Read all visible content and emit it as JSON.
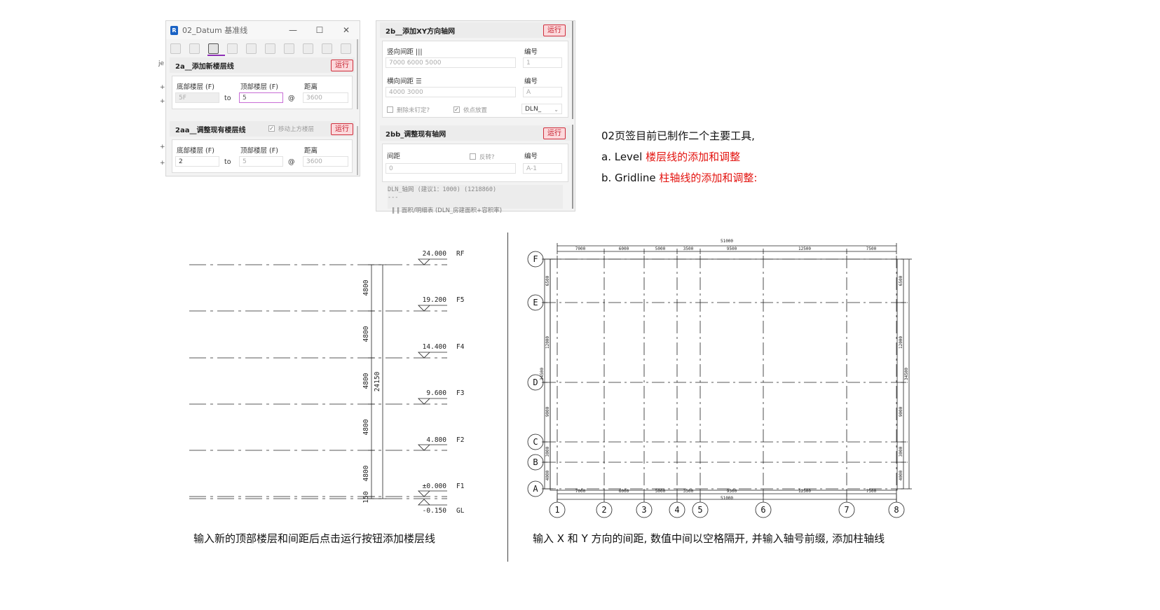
{
  "window1": {
    "title": "02_Datum 基准线",
    "controls": [
      "—",
      "☐",
      "✕"
    ],
    "panel_2a": {
      "title": "2a__添加新楼层线",
      "run": "运行",
      "bottom_label": "底部楼层 (F)",
      "top_label": "顶部楼层 (F)",
      "dist_label": "距离",
      "bottom_value": "5F",
      "to": "to",
      "top_value": "5",
      "at": "@",
      "dist_value": "3600"
    },
    "panel_2aa": {
      "title": "2aa__调整现有楼层线",
      "move_label": "移动上方楼层",
      "run": "运行",
      "bottom_label": "底部楼层 (F)",
      "top_label": "顶部楼层 (F)",
      "dist_label": "距离",
      "bottom_value": "2",
      "to": "to",
      "top_value": "5",
      "at": "@",
      "dist_value": "3600"
    },
    "left_glyphs": [
      "je",
      "+",
      "+",
      "+",
      "+"
    ]
  },
  "window2": {
    "panel_2b": {
      "title": "2b__添加XY方向轴网",
      "run": "运行",
      "vspacing_label": "竖向间距 |||",
      "vspacing_value": "7000 6000 5000",
      "num_label1": "编号",
      "num_value1": "1",
      "hspacing_label": "横向间距 ☰",
      "hspacing_value": "4000 3000",
      "num_label2": "编号",
      "num_value2": "A",
      "delete_label": "删除未钉定?",
      "snap_label": "依点放置",
      "prefix_value": "DLN_"
    },
    "panel_2bb": {
      "title": "2bb_调整现有轴网",
      "run": "运行",
      "spacing_label": "间距",
      "reverse_label": "反转?",
      "num_label": "编号",
      "spacing_value": "0",
      "num_value": "A-1"
    },
    "log_lines": [
      "DLN_轴网 (建议1：1000)  (1218860)",
      "---",
      "‖ ‖ 面积/明细表 (DLN_房建面积+容积率)"
    ]
  },
  "notes": {
    "line1": "02页签目前已制作二个主要工具,",
    "line2_prefix": "a. Level ",
    "line2_red": "楼层线的添加和调整",
    "line3_prefix": "b. Gridline ",
    "line3_red": "柱轴线的添加和调整:"
  },
  "levels": {
    "items": [
      {
        "elev": "24.000",
        "name": "RF"
      },
      {
        "elev": "19.200",
        "name": "F5"
      },
      {
        "elev": "14.400",
        "name": "F4"
      },
      {
        "elev": "9.600",
        "name": "F3"
      },
      {
        "elev": "4.800",
        "name": "F2"
      },
      {
        "elev": "±0.000",
        "name": "F1"
      },
      {
        "elev": "-0.150",
        "name": "GL"
      }
    ],
    "spacing_dims": [
      "4800",
      "4800",
      "4800",
      "4800",
      "4800",
      "150"
    ],
    "total_dim": "24150",
    "caption": "输入新的顶部楼层和间距后点击运行按钮添加楼层线"
  },
  "grid": {
    "columns": [
      "1",
      "2",
      "3",
      "4",
      "5",
      "6",
      "7",
      "8"
    ],
    "rows": [
      "F",
      "E",
      "D",
      "C",
      "B",
      "A"
    ],
    "col_spacing": [
      "7000",
      "6000",
      "5000",
      "3500",
      "9500",
      "12500",
      "7500"
    ],
    "total_width": "51000",
    "row_spacing_left": [
      "6500",
      "12000",
      "9000",
      "3000",
      "4000"
    ],
    "row_spacing_right": [
      "6500",
      "12000",
      "9000",
      "3000",
      "4000"
    ],
    "total_height": "34500",
    "caption": "输入 X 和 Y 方向的间距, 数值中间以空格隔开, 并输入轴号前缀, 添加柱轴线"
  }
}
